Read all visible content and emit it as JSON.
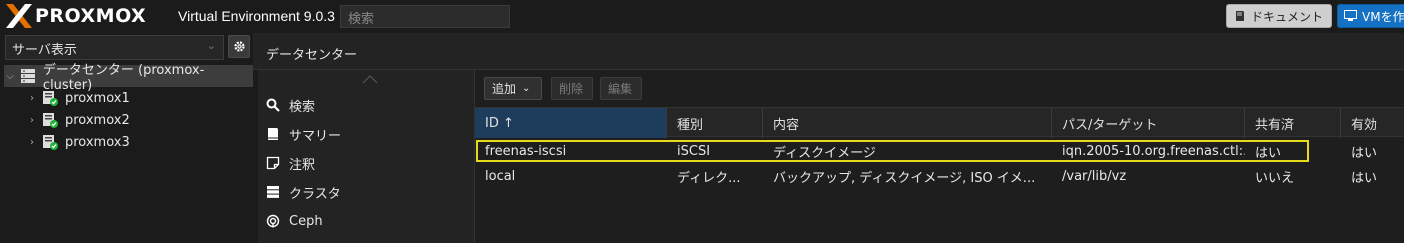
{
  "header": {
    "logo_text": "PROXMOX",
    "version": "Virtual Environment 9.0.3",
    "search_placeholder": "検索",
    "doc_button": "ドキュメント",
    "vm_button": "VMを作"
  },
  "sidebar": {
    "view_label": "サーバ表示",
    "tree": {
      "root": "データセンター (proxmox-cluster)",
      "nodes": [
        "proxmox1",
        "proxmox2",
        "proxmox3"
      ]
    }
  },
  "main": {
    "title": "データセンター",
    "nav": [
      {
        "label": "検索",
        "icon": "search-icon"
      },
      {
        "label": "サマリー",
        "icon": "book-icon"
      },
      {
        "label": "注釈",
        "icon": "note-icon"
      },
      {
        "label": "クラスタ",
        "icon": "server-icon"
      },
      {
        "label": "Ceph",
        "icon": "ceph-icon"
      }
    ],
    "toolbar": {
      "add": "追加",
      "remove": "削除",
      "edit": "編集"
    },
    "columns": [
      "ID ↑",
      "種別",
      "内容",
      "パス/ターゲット",
      "共有済",
      "有効"
    ],
    "rows": [
      [
        "freenas-iscsi",
        "iSCSI",
        "ディスクイメージ",
        "iqn.2005-10.org.freenas.ctl:...",
        "はい",
        "はい"
      ],
      [
        "local",
        "ディレク...",
        "バックアップ, ディスクイメージ, ISO イメ...",
        "/var/lib/vz",
        "いいえ",
        "はい"
      ]
    ]
  },
  "colors": {
    "highlight": "#e6db1b",
    "accent": "#1571c4",
    "status_ok": "#22b33a"
  }
}
